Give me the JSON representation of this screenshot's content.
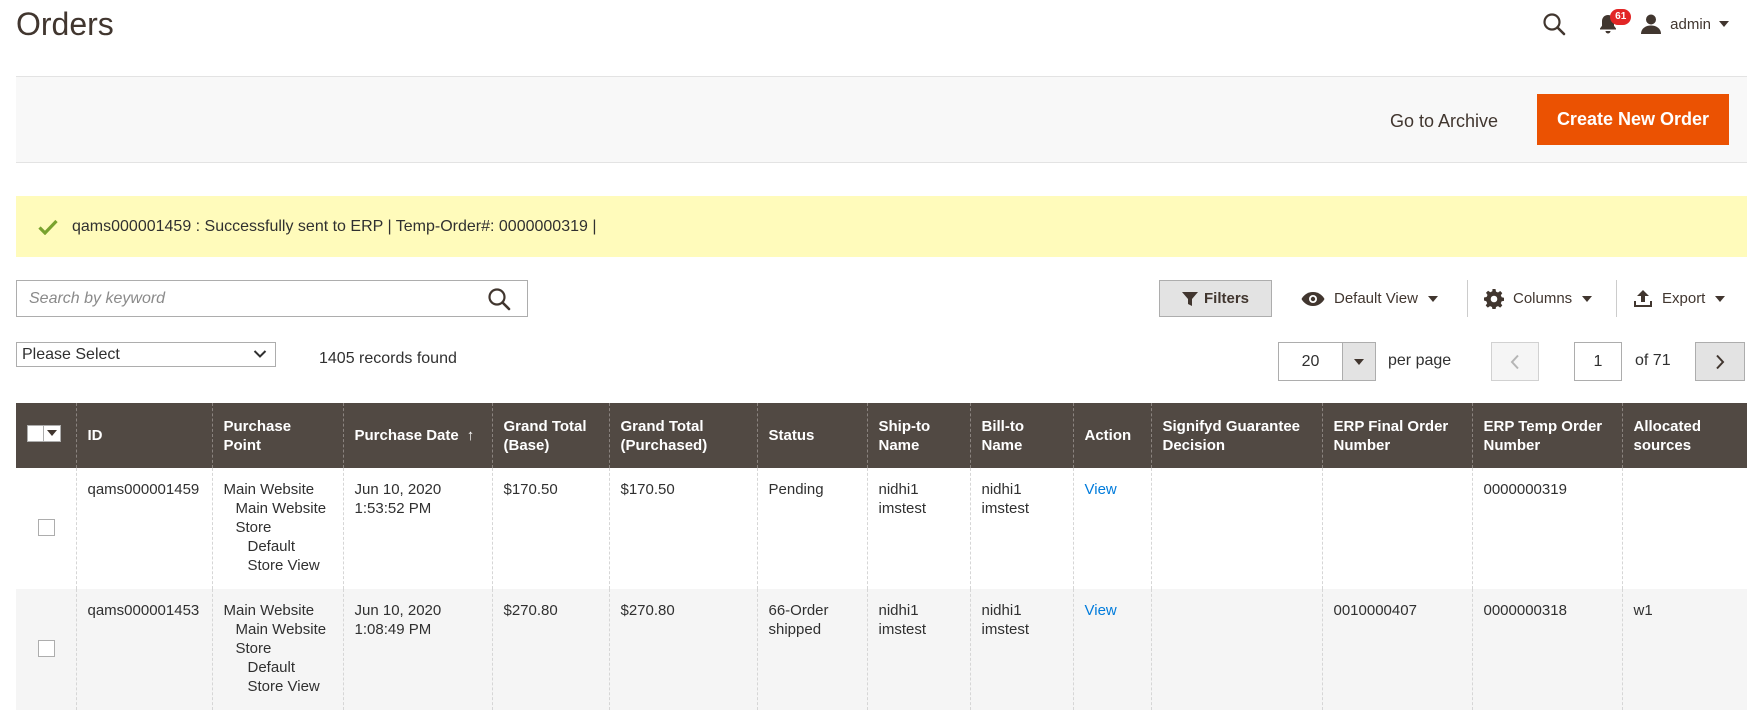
{
  "page": {
    "title": "Orders"
  },
  "header": {
    "notification_count": "61",
    "user_name": "admin"
  },
  "actions": {
    "archive_label": "Go to Archive",
    "create_label": "Create New Order"
  },
  "message": {
    "text": "qams000001459 : Successfully sent to ERP | Temp-Order#: 0000000319 |"
  },
  "toolbar": {
    "search_placeholder": "Search by keyword",
    "filters_label": "Filters",
    "view_label": "Default View",
    "columns_label": "Columns",
    "export_label": "Export",
    "select_label": "Please Select",
    "records_found": "1405 records found",
    "per_page_value": "20",
    "per_page_label": "per page",
    "current_page": "1",
    "of_pages": "of 71"
  },
  "grid": {
    "columns": {
      "id": "ID",
      "purchase_point": "Purchase Point",
      "purchase_date": "Purchase Date",
      "grand_total_base": "Grand Total (Base)",
      "grand_total_purchased": "Grand Total (Purchased)",
      "status": "Status",
      "ship_to": "Ship-to Name",
      "bill_to": "Bill-to Name",
      "action": "Action",
      "signifyd": "Signifyd Guarantee Decision",
      "erp_final": "ERP Final Order Number",
      "erp_temp": "ERP Temp Order Number",
      "allocated": "Allocated sources"
    },
    "sort_indicator": "↑",
    "rows": [
      {
        "id": "qams000001459",
        "pp_website": "Main Website",
        "pp_store": "Main Website Store",
        "pp_view": "Default Store View",
        "purchase_date": "Jun 10, 2020 1:53:52 PM",
        "grand_total_base": "$170.50",
        "grand_total_purchased": "$170.50",
        "status": "Pending",
        "ship_to": "nidhi1 imstest",
        "bill_to": "nidhi1 imstest",
        "action": "View",
        "signifyd": "",
        "erp_final": "",
        "erp_temp": "0000000319",
        "allocated": ""
      },
      {
        "id": "qams000001453",
        "pp_website": "Main Website",
        "pp_store": "Main Website Store",
        "pp_view": "Default Store View",
        "purchase_date": "Jun 10, 2020 1:08:49 PM",
        "grand_total_base": "$270.80",
        "grand_total_purchased": "$270.80",
        "status": "66-Order shipped",
        "ship_to": "nidhi1 imstest",
        "bill_to": "nidhi1 imstest",
        "action": "View",
        "signifyd": "",
        "erp_final": "0010000407",
        "erp_temp": "0000000318",
        "allocated": "w1"
      }
    ]
  },
  "colors": {
    "accent": "#eb5202",
    "header_bg": "#514943",
    "message_bg": "#fffbbb",
    "link": "#007bdb",
    "success": "#79a22e"
  },
  "icons": [
    "search-icon",
    "bell-icon",
    "user-icon",
    "check-icon",
    "filter-icon",
    "eye-icon",
    "gear-icon",
    "upload-icon",
    "chevron-down-icon",
    "chevron-left-icon",
    "chevron-right-icon",
    "caret-down-icon"
  ]
}
